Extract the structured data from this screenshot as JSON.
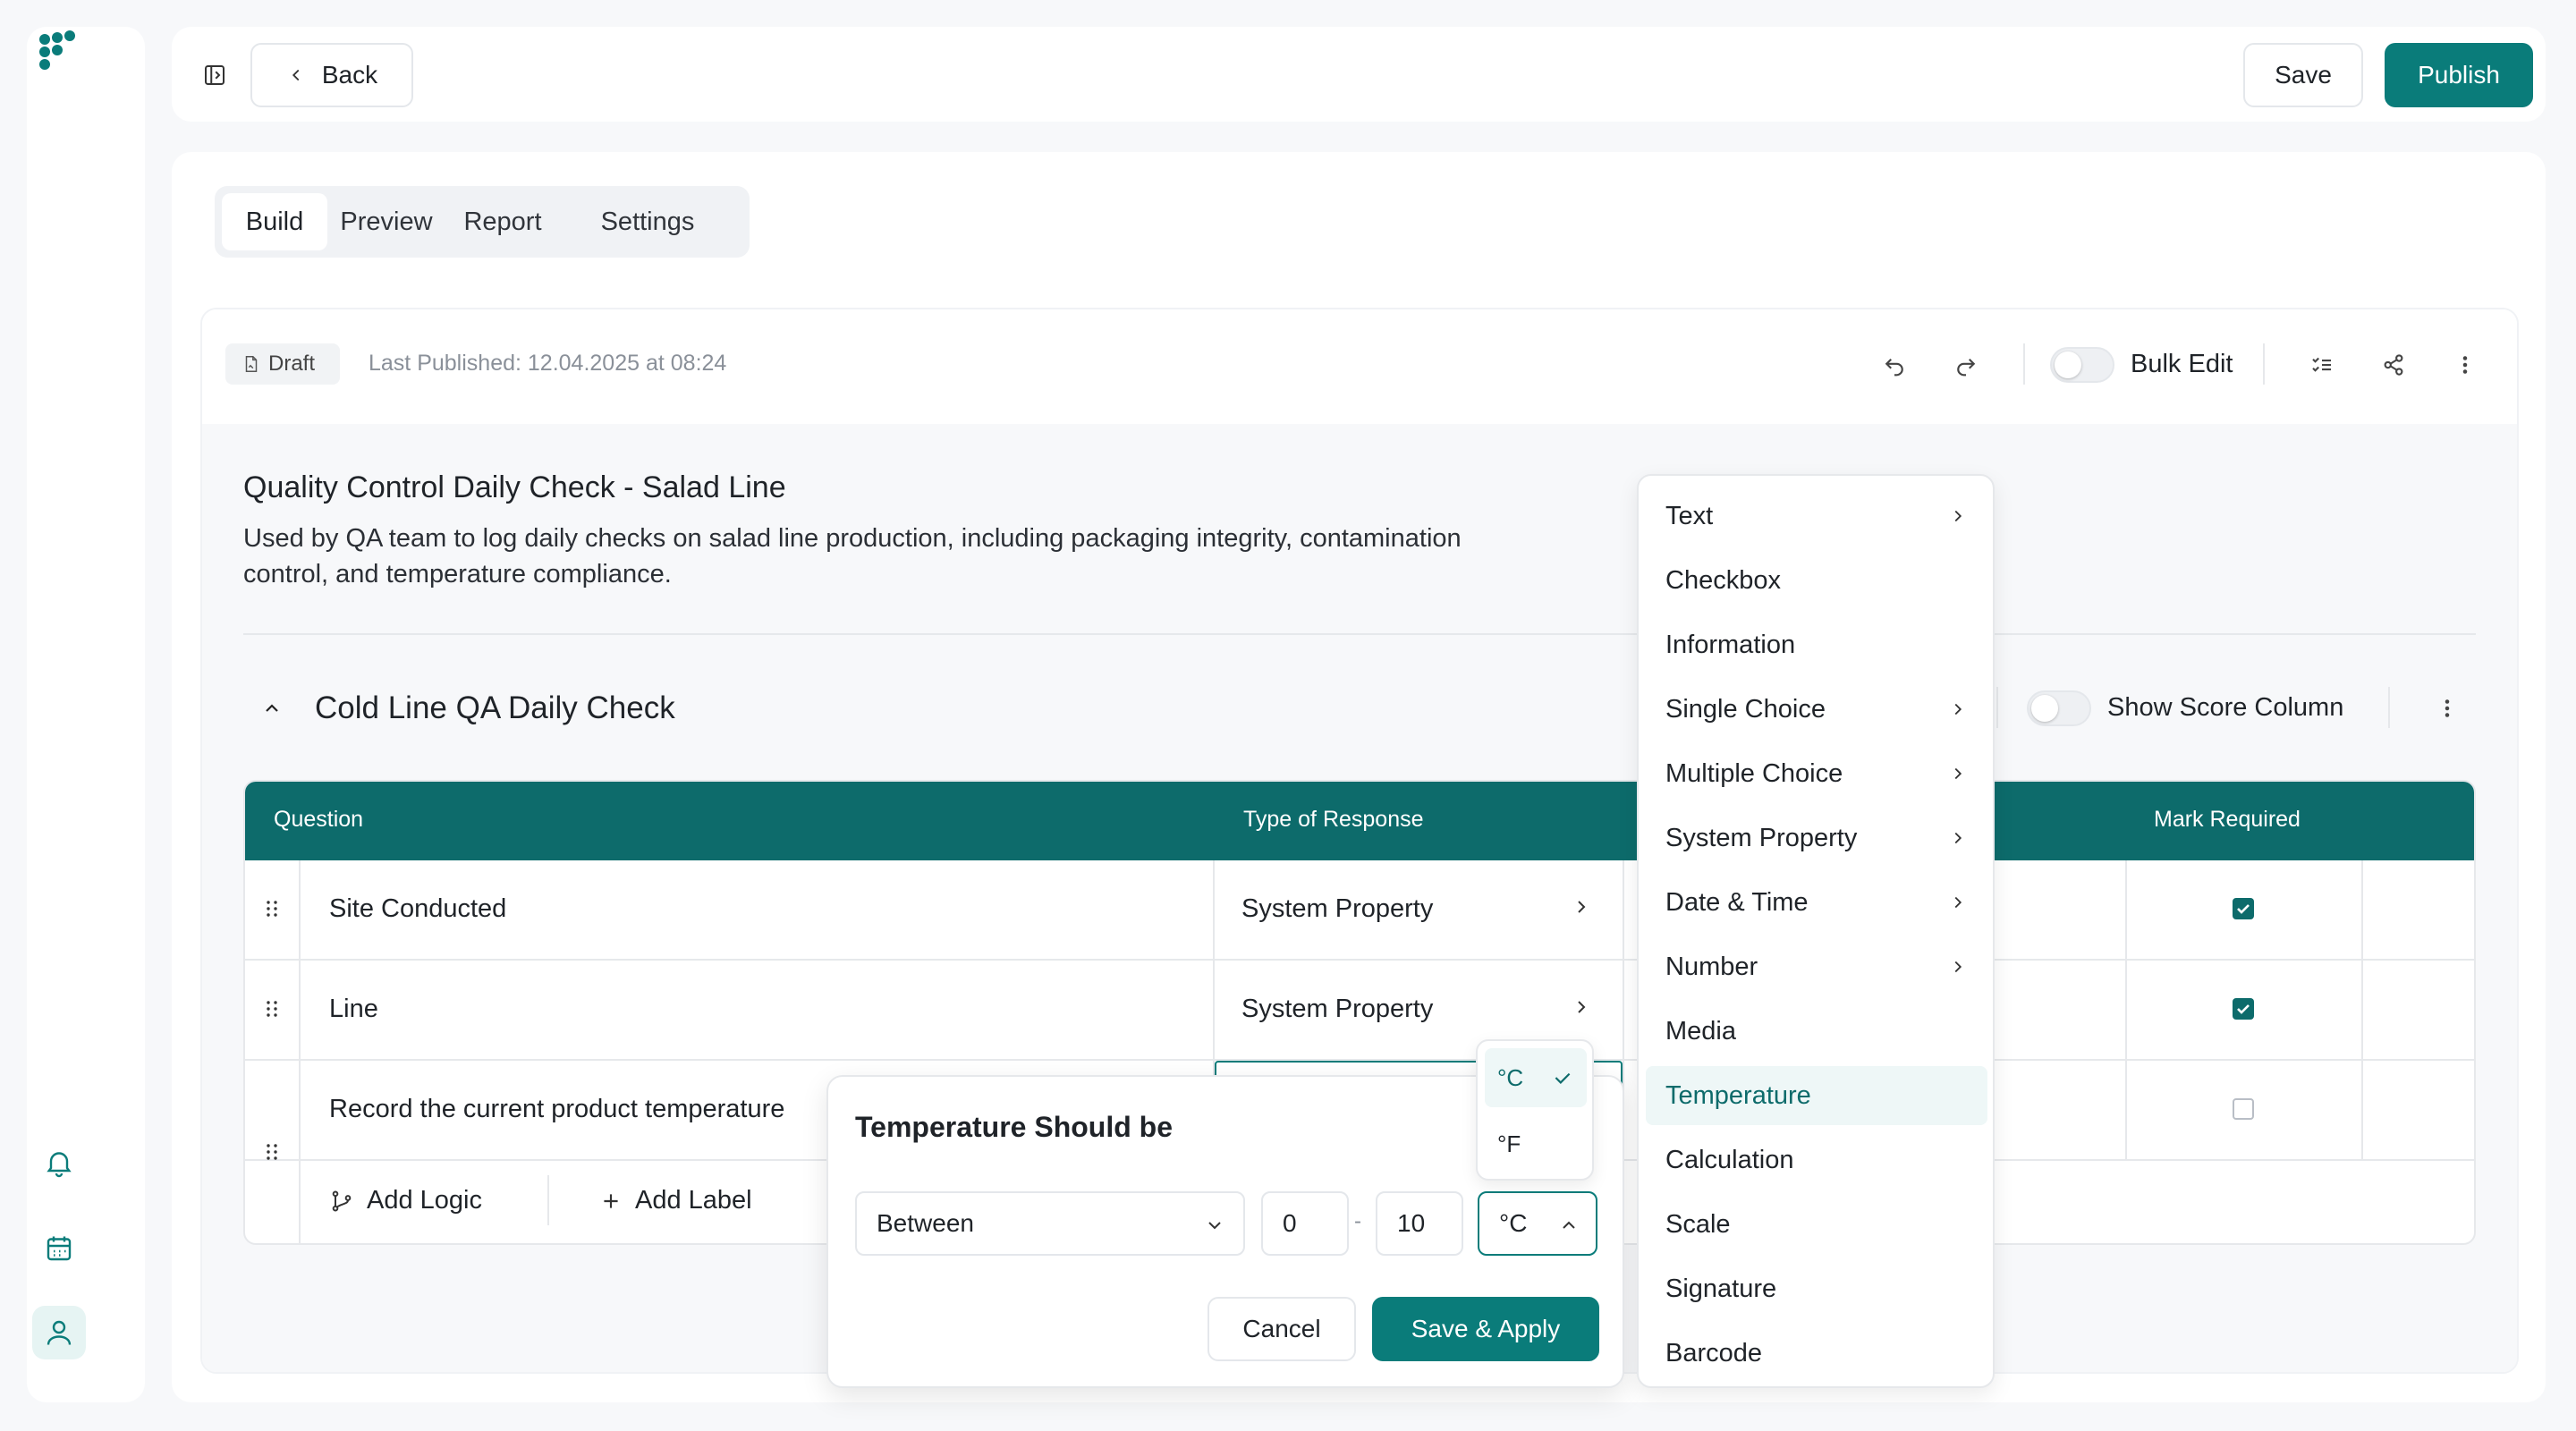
{
  "app": {
    "brand_color": "#0a7c7a",
    "logo_icon": "logo-dots-icon"
  },
  "sidebar": {
    "items": [
      {
        "name": "notifications",
        "icon": "bell-icon"
      },
      {
        "name": "calendar",
        "icon": "calendar-icon"
      },
      {
        "name": "profile",
        "icon": "user-icon",
        "active": true
      }
    ]
  },
  "topbar": {
    "back_label": "Back",
    "save_label": "Save",
    "publish_label": "Publish"
  },
  "tabs": [
    {
      "label": "Build",
      "active": true
    },
    {
      "label": "Preview"
    },
    {
      "label": "Report"
    },
    {
      "label": "Settings"
    }
  ],
  "status": {
    "badge": "Draft",
    "last_published": "Last Published: 12.04.2025 at 08:24",
    "bulk_edit_label": "Bulk Edit",
    "bulk_edit_on": false
  },
  "form": {
    "title": "Quality Control Daily Check - Salad Line",
    "description_line1": "Used by QA team to log daily checks on salad line production, including packaging integrity, contamination",
    "description_line2": "control, and temperature compliance."
  },
  "section": {
    "title": "Cold Line QA Daily Check",
    "show_score_label": "Show Score Column",
    "show_score_on": false
  },
  "table": {
    "headers": {
      "question": "Question",
      "type": "Type of Response",
      "required": "Mark Required"
    },
    "rows": [
      {
        "question": "Site Conducted",
        "type": "System Property",
        "required": true
      },
      {
        "question": "Line",
        "type": "System Property",
        "required": true
      },
      {
        "question": "Record the current product temperature",
        "type": "",
        "required": false
      }
    ],
    "add_logic_label": "Add Logic",
    "add_label_label": "Add Label"
  },
  "type_menu": [
    {
      "label": "Text",
      "submenu": true
    },
    {
      "label": "Checkbox"
    },
    {
      "label": "Information"
    },
    {
      "label": "Single Choice",
      "submenu": true
    },
    {
      "label": "Multiple Choice",
      "submenu": true
    },
    {
      "label": "System Property",
      "submenu": true
    },
    {
      "label": "Date & Time",
      "submenu": true
    },
    {
      "label": "Number",
      "submenu": true
    },
    {
      "label": "Media"
    },
    {
      "label": "Temperature",
      "selected": true
    },
    {
      "label": "Calculation"
    },
    {
      "label": "Scale"
    },
    {
      "label": "Signature"
    },
    {
      "label": "Barcode"
    }
  ],
  "temp_popup": {
    "title": "Temperature Should be",
    "condition": "Between",
    "min": "0",
    "separator": "-",
    "max": "10",
    "unit": "°C",
    "cancel_label": "Cancel",
    "apply_label": "Save & Apply"
  },
  "unit_options": [
    {
      "label": "°C",
      "selected": true
    },
    {
      "label": "°F"
    }
  ]
}
